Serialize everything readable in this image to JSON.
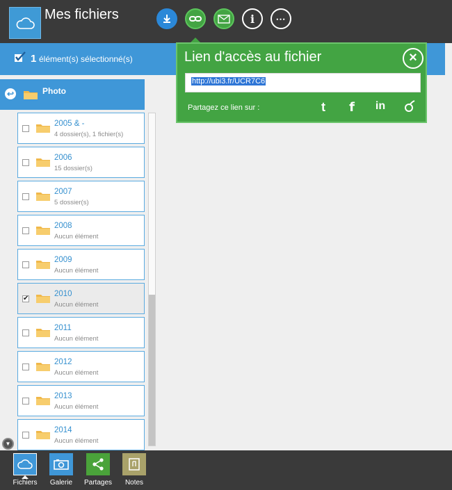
{
  "app": {
    "title": "Mes fichiers",
    "brand_color": "#3f97d8",
    "icon": "cloud-icon"
  },
  "toolbar": {
    "buttons": [
      {
        "icon": "download-icon",
        "color": "#2b88d8"
      },
      {
        "icon": "link-icon",
        "color": "#43a443",
        "active": true
      },
      {
        "icon": "mail-icon",
        "color": "#43a443"
      },
      {
        "icon": "info-icon",
        "glyph": "i"
      },
      {
        "icon": "more-icon",
        "glyph": "⋯"
      }
    ]
  },
  "selection": {
    "count": "1",
    "text": "élément(s) sélectionné(s)"
  },
  "link_popup": {
    "title": "Lien d'accès au fichier",
    "close_glyph": "×",
    "url": "http://ubi3.fr/UCR7C6",
    "share_label": "Partagez ce lien sur :",
    "share_networks": [
      {
        "icon": "twitter-icon",
        "glyph": "t"
      },
      {
        "icon": "facebook-icon",
        "glyph": "f"
      },
      {
        "icon": "linkedin-icon",
        "glyph": "in"
      },
      {
        "icon": "viadeo-icon",
        "glyph": "v"
      }
    ],
    "color": "#43a443"
  },
  "folder_panel": {
    "current": "Photo",
    "back_glyph": "↩",
    "items": [
      {
        "name": "2005 & -",
        "info": "4 dossier(s), 1 fichier(s)",
        "checked": false,
        "check_glyph": ""
      },
      {
        "name": "2006",
        "info": "15 dossier(s)",
        "checked": false,
        "check_glyph": ""
      },
      {
        "name": "2007",
        "info": "5 dossier(s)",
        "checked": false,
        "check_glyph": ""
      },
      {
        "name": "2008",
        "info": "Aucun élément",
        "checked": false,
        "check_glyph": ""
      },
      {
        "name": "2009",
        "info": "Aucun élément",
        "checked": false,
        "check_glyph": ""
      },
      {
        "name": "2010",
        "info": "Aucun élément",
        "checked": true,
        "check_glyph": "✔"
      },
      {
        "name": "2011",
        "info": "Aucun élément",
        "checked": false,
        "check_glyph": ""
      },
      {
        "name": "2012",
        "info": "Aucun élément",
        "checked": false,
        "check_glyph": ""
      },
      {
        "name": "2013",
        "info": "Aucun élément",
        "checked": false,
        "check_glyph": ""
      },
      {
        "name": "2014",
        "info": "Aucun élément",
        "checked": false,
        "check_glyph": ""
      }
    ]
  },
  "collapse_glyph": "▼",
  "bottom_nav": {
    "items": [
      {
        "label": "Fichiers",
        "icon": "cloud-icon",
        "active": true
      },
      {
        "label": "Galerie",
        "icon": "camera-icon"
      },
      {
        "label": "Partages",
        "icon": "share-icon"
      },
      {
        "label": "Notes",
        "icon": "notes-icon"
      }
    ]
  }
}
